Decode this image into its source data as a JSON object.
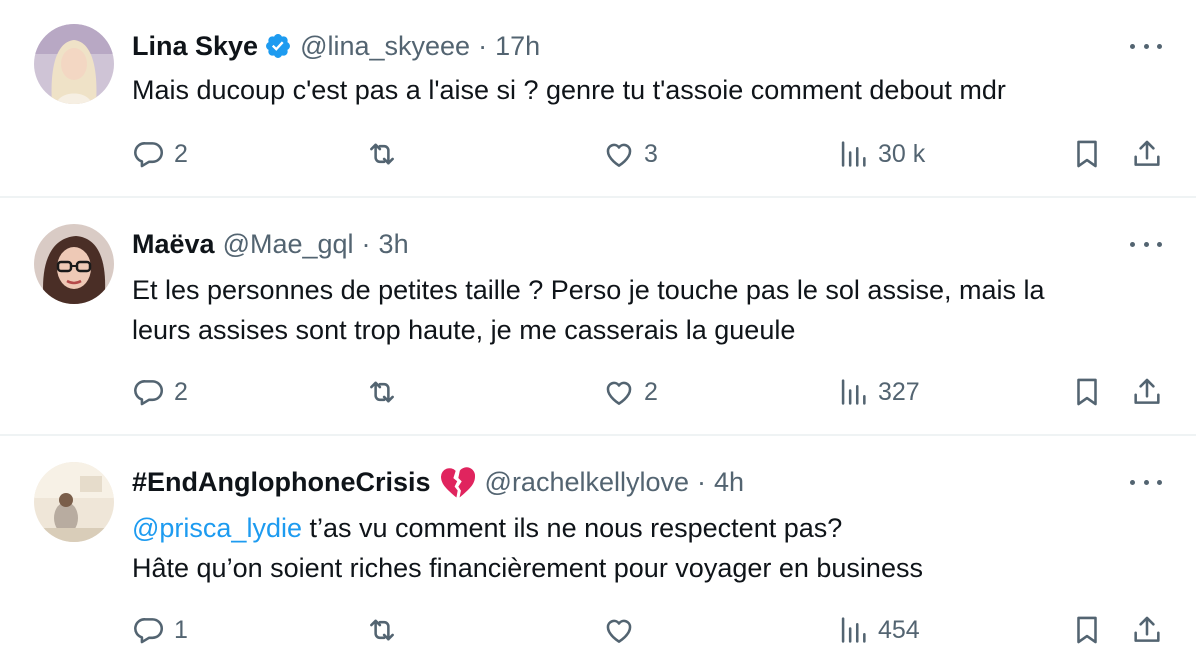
{
  "tweets": [
    {
      "name": "Lina Skye",
      "verified": true,
      "handle": "@lina_skyeee",
      "sep": "·",
      "time": "17h",
      "lines": [
        "Mais ducoup c'est pas a l'aise si ?  genre tu t'assoie comment debout mdr"
      ],
      "replies": "2",
      "reposts": "",
      "likes": "3",
      "views": "30 k"
    },
    {
      "name": "Maëva",
      "verified": false,
      "handle": "@Mae_gql",
      "sep": "·",
      "time": "3h",
      "lines": [
        "Et les personnes de petites taille ? Perso je touche pas le sol assise, mais la",
        "leurs assises sont trop haute, je me casserais la gueule"
      ],
      "replies": "2",
      "reposts": "",
      "likes": "2",
      "views": "327"
    },
    {
      "name": "#EndAnglophoneCrisis",
      "verified": false,
      "name_emoji": "broken-heart-icon",
      "handle": "@rachelkellylove",
      "sep": "·",
      "time": "4h",
      "mention": "@prisca_lydie",
      "line1_rest": " t’as vu comment ils ne nous respectent pas?",
      "line2": "Hâte qu’on soient riches financièrement pour voyager en business",
      "replies": "1",
      "reposts": "",
      "likes": "",
      "views": "454"
    }
  ],
  "colors": {
    "text": "#0f1419",
    "secondary": "#536471",
    "accent": "#1d9bf0",
    "divider": "#eff3f4",
    "broken_heart": "#e0245e"
  },
  "icons": [
    "reply-icon",
    "repost-icon",
    "like-icon",
    "views-icon",
    "bookmark-icon",
    "share-icon",
    "more-icon",
    "verified-badge-icon",
    "broken-heart-icon"
  ]
}
